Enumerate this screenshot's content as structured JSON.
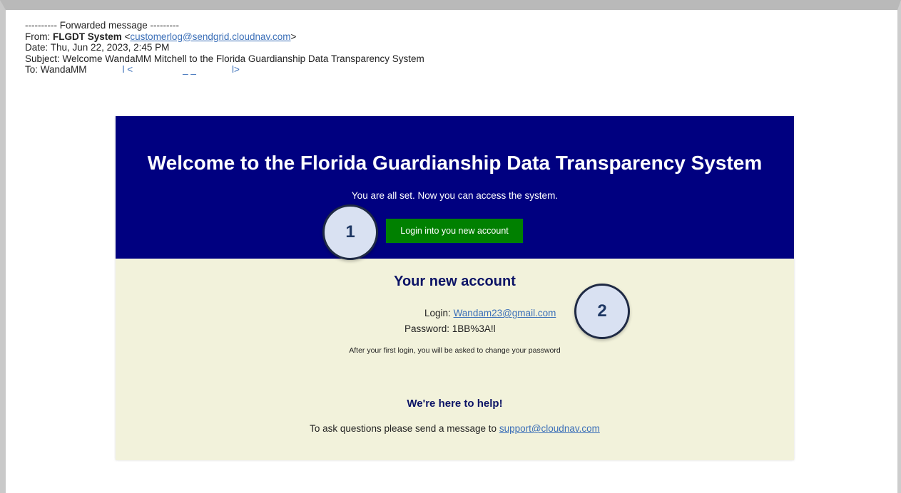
{
  "email_header": {
    "forwarded_line": "---------- Forwarded message ---------",
    "from_prefix": "From: ",
    "from_name": "FLGDT System",
    "from_email_open": " <",
    "from_email": "customerlog@sendgrid.cloudnav.com",
    "from_email_close": ">",
    "date": "Date: Thu, Jun 22, 2023, 2:45 PM",
    "subject": "Subject: Welcome WandaMM Mitchell to the Florida Guardianship Data Transparency System",
    "to_prefix": "To: WandaMM",
    "to_fragment_1": "l <",
    "to_fragment_2": "_ _",
    "to_fragment_3": "l>"
  },
  "hero": {
    "title": "Welcome to the Florida Guardianship Data Transparency System",
    "subtitle": "You are all set. Now you can access the system.",
    "login_button": "Login into you new account"
  },
  "account": {
    "title": "Your new account",
    "login_label": "Login:",
    "login_value": "Wandam23@gmail.com",
    "password_label": "Password:",
    "password_value": "1BB%3A!l",
    "notice": "After your first login, you will be asked to change your password"
  },
  "help": {
    "title": "We're here to help!",
    "text": "To ask questions please send a message to ",
    "email": "support@cloudnav.com"
  },
  "callouts": [
    "1",
    "2"
  ],
  "colors": {
    "hero_bg": "#000080",
    "account_bg": "#f2f2db",
    "button_bg": "#008000",
    "heading_text": "#0c1466",
    "link": "#3b6fb8",
    "callout_fill": "#d9e1f2",
    "callout_border": "#1f2a44"
  }
}
